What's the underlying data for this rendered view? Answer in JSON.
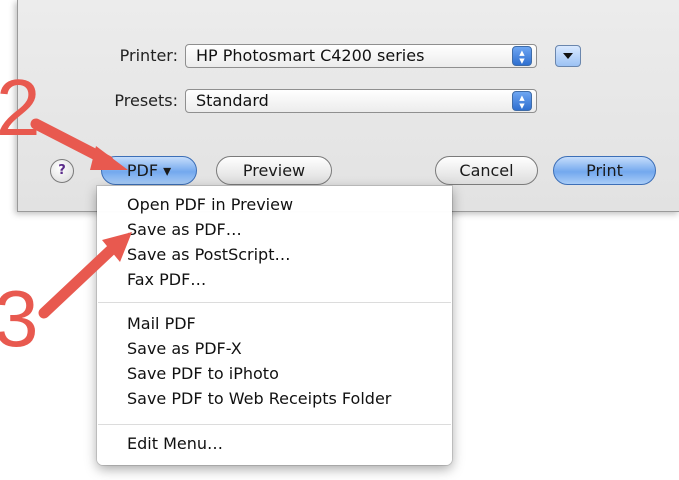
{
  "dialog": {
    "printer_label": "Printer:",
    "printer_value": "HP Photosmart C4200 series",
    "presets_label": "Presets:",
    "presets_value": "Standard"
  },
  "buttons": {
    "help": "?",
    "pdf": "PDF ▾",
    "preview": "Preview",
    "cancel": "Cancel",
    "print": "Print"
  },
  "pdf_menu": {
    "groups": [
      [
        "Open PDF in Preview",
        "Save as PDF…",
        "Save as PostScript…",
        "Fax PDF…"
      ],
      [
        "Mail PDF",
        "Save as PDF-X",
        "Save PDF to iPhoto",
        "Save PDF to Web Receipts Folder"
      ],
      [
        "Edit Menu…"
      ]
    ]
  },
  "annotations": {
    "step2": "2",
    "step3": "3",
    "color": "#e8594f"
  },
  "accent": "#4f8ae6"
}
